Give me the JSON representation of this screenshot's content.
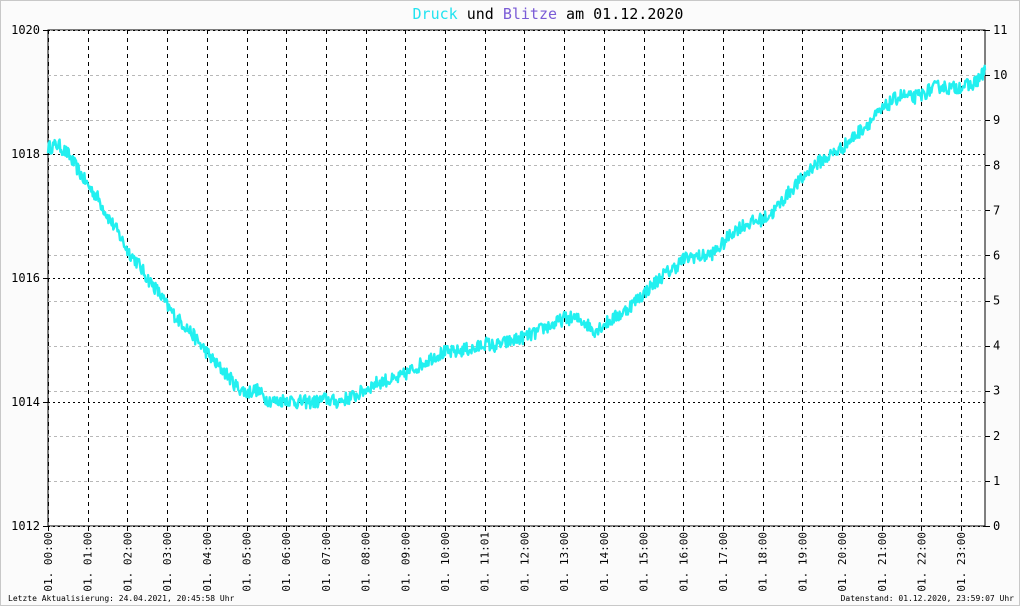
{
  "title": {
    "word1": "Druck",
    "word2": " und ",
    "word3": "Blitze",
    "word4": " am 01.12.2020",
    "color1": "#22e3f0",
    "color3": "#7a5bd6"
  },
  "footer": {
    "left": "Letzte Aktualisierung: 24.04.2021, 20:45:58 Uhr",
    "right": "Datenstand: 01.12.2020, 23:59:07 Uhr"
  },
  "chart_data": {
    "type": "line",
    "title": "Druck und Blitze am 01.12.2020",
    "x_unit": "hour of day",
    "x_ticks": [
      "01. 00:00",
      "01. 01:00",
      "01. 02:00",
      "01. 03:00",
      "01. 04:00",
      "01. 05:00",
      "01. 06:00",
      "01. 07:00",
      "01. 08:00",
      "01. 09:00",
      "01. 10:00",
      "01. 11:01",
      "01. 12:00",
      "01. 13:00",
      "01. 14:00",
      "01. 15:00",
      "01. 16:00",
      "01. 17:00",
      "01. 18:00",
      "01. 19:00",
      "01. 20:00",
      "01. 21:00",
      "01. 22:00",
      "01. 23:00"
    ],
    "y_left": {
      "ticks": [
        "1012",
        "1014",
        "1016",
        "1018",
        "1020"
      ],
      "ylim": [
        1012,
        1020
      ]
    },
    "y_right": {
      "ticks": [
        "0",
        "1",
        "2",
        "3",
        "4",
        "5",
        "6",
        "7",
        "8",
        "9",
        "10",
        "11"
      ],
      "ylim": [
        0,
        11
      ]
    },
    "xlim": [
      0,
      23.6
    ],
    "grid": true,
    "series": [
      {
        "name": "Druck",
        "color": "#22f0f0",
        "axis": "left",
        "x": [
          0,
          0.25,
          0.5,
          0.75,
          1.0,
          1.25,
          1.5,
          1.75,
          2.0,
          2.25,
          2.5,
          2.75,
          3.0,
          3.25,
          3.5,
          3.75,
          4.0,
          4.25,
          4.5,
          4.75,
          5.0,
          5.25,
          5.5,
          5.75,
          6.0,
          6.25,
          6.5,
          6.75,
          7.0,
          7.25,
          7.5,
          7.75,
          8.0,
          8.25,
          8.5,
          8.75,
          9.0,
          9.25,
          9.5,
          9.75,
          10.0,
          10.25,
          10.5,
          10.75,
          11.0,
          11.25,
          11.5,
          11.75,
          12.0,
          12.25,
          12.5,
          12.75,
          13.0,
          13.25,
          13.5,
          13.75,
          14.0,
          14.25,
          14.5,
          14.75,
          15.0,
          15.25,
          15.5,
          15.75,
          16.0,
          16.25,
          16.5,
          16.75,
          17.0,
          17.25,
          17.5,
          17.75,
          18.0,
          18.25,
          18.5,
          18.75,
          19.0,
          19.25,
          19.5,
          19.75,
          20.0,
          20.25,
          20.5,
          20.75,
          21.0,
          21.25,
          21.5,
          21.75,
          22.0,
          22.25,
          22.5,
          22.75,
          23.0,
          23.25,
          23.5,
          23.6
        ],
        "values": [
          1018.1,
          1018.15,
          1018.0,
          1017.75,
          1017.5,
          1017.3,
          1017.0,
          1016.75,
          1016.45,
          1016.25,
          1016.0,
          1015.8,
          1015.55,
          1015.35,
          1015.2,
          1015.0,
          1014.8,
          1014.6,
          1014.45,
          1014.25,
          1014.15,
          1014.2,
          1014.05,
          1014.0,
          1014.05,
          1014.0,
          1014.0,
          1014.0,
          1014.05,
          1014.0,
          1014.05,
          1014.1,
          1014.2,
          1014.3,
          1014.35,
          1014.35,
          1014.45,
          1014.55,
          1014.65,
          1014.75,
          1014.8,
          1014.8,
          1014.85,
          1014.85,
          1014.95,
          1014.9,
          1014.95,
          1015.0,
          1015.05,
          1015.1,
          1015.2,
          1015.25,
          1015.35,
          1015.35,
          1015.3,
          1015.15,
          1015.25,
          1015.35,
          1015.45,
          1015.6,
          1015.75,
          1015.9,
          1016.05,
          1016.15,
          1016.3,
          1016.35,
          1016.35,
          1016.4,
          1016.55,
          1016.75,
          1016.85,
          1016.9,
          1016.95,
          1017.05,
          1017.25,
          1017.45,
          1017.6,
          1017.8,
          1017.9,
          1018.0,
          1018.1,
          1018.25,
          1018.4,
          1018.55,
          1018.7,
          1018.85,
          1018.95,
          1018.9,
          1018.95,
          1019.05,
          1019.1,
          1019.05,
          1019.1,
          1019.1,
          1019.25,
          1019.35
        ]
      }
    ]
  }
}
